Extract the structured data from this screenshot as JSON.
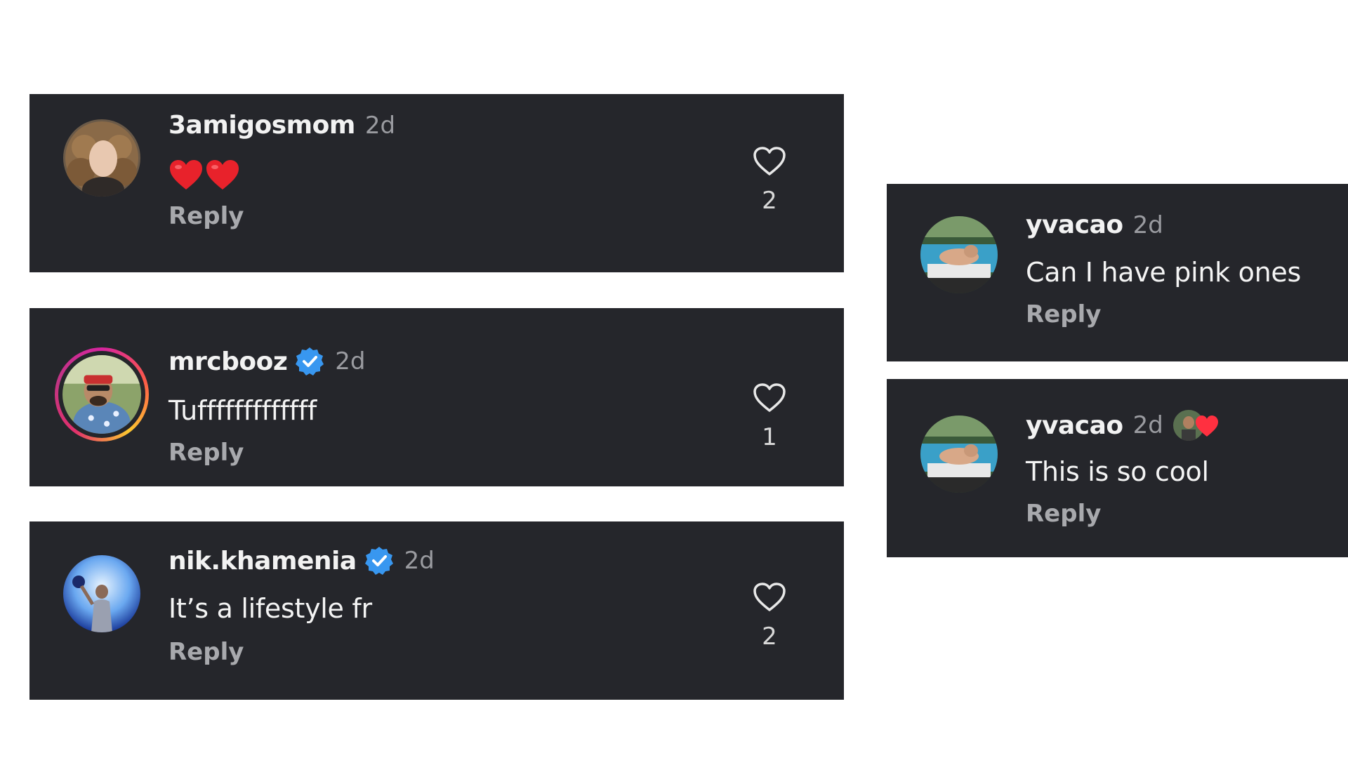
{
  "comments": [
    {
      "username": "3amigosmom",
      "time": "2d",
      "text": "",
      "emoji": "❤️❤️",
      "reply_label": "Reply",
      "likes": "2",
      "verified": false
    },
    {
      "username": "mrcbooz",
      "time": "2d",
      "text": "Tufffffffffffff",
      "reply_label": "Reply",
      "likes": "1",
      "verified": true
    },
    {
      "username": "nik.khamenia",
      "time": "2d",
      "text": "It’s a lifestyle fr",
      "reply_label": "Reply",
      "likes": "2",
      "verified": true
    },
    {
      "username": "yvacao",
      "time": "2d",
      "text": "Can I have pink ones",
      "reply_label": "Reply",
      "verified": false
    },
    {
      "username": "yvacao",
      "time": "2d",
      "text": "This is so cool",
      "reply_label": "Reply",
      "verified": false,
      "liked_by_creator": true
    }
  ],
  "colors": {
    "card_background": "#25262b",
    "verified_blue": "#3897f0",
    "heart_red": "#ff3040"
  },
  "icons": [
    "heart-outline-icon",
    "verified-badge-icon",
    "red-heart-emoji"
  ]
}
